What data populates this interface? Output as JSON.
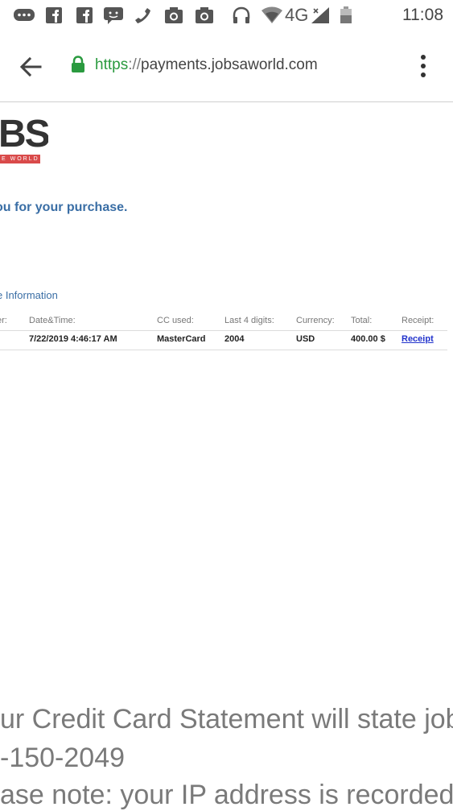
{
  "status_bar": {
    "network_label": "4G",
    "time": "11:08",
    "icons": [
      "messages-icon",
      "facebook-icon",
      "facebook-icon",
      "chat-icon",
      "phone-icon",
      "camera-icon",
      "camera-icon",
      "headphones-icon",
      "signal-icon",
      "battery-icon"
    ]
  },
  "browser": {
    "url_scheme": "https",
    "url_sep": "://",
    "url_host": "payments.jobsaworld.com",
    "accent_color": "#2a9a3f"
  },
  "page": {
    "logo_text": "BS",
    "logo_strip_text": "E WORLD",
    "thanks": "ou for your purchase.",
    "section_title": "e Information",
    "table": {
      "headers": [
        "er:",
        "Date&Time:",
        "CC used:",
        "Last 4 digits:",
        "Currency:",
        "Total:",
        "Receipt:"
      ],
      "row": {
        "datetime": "7/22/2019 4:46:17 AM",
        "cc_used": "MasterCard",
        "last4": "2004",
        "currency": "USD",
        "total": "400.00 $",
        "receipt": "Receipt"
      }
    },
    "footer_line1": "ur Credit Card Statement will state job",
    "footer_line2": "-150-2049",
    "footer_line3": "ase note: your IP address is recorded f"
  }
}
